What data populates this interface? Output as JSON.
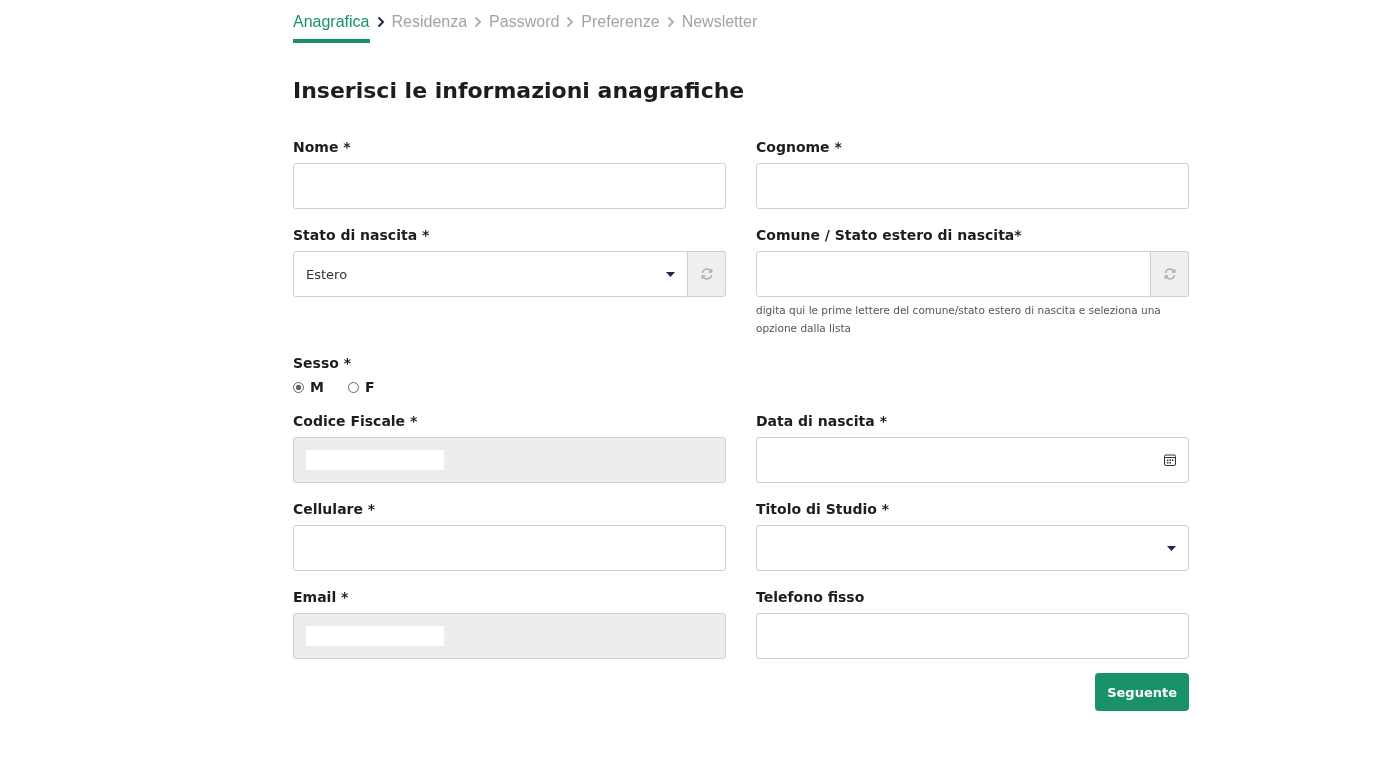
{
  "steps": [
    {
      "label": "Anagrafica",
      "selected": true
    },
    {
      "label": "Residenza",
      "selected": false
    },
    {
      "label": "Password",
      "selected": false
    },
    {
      "label": "Preferenze",
      "selected": false
    },
    {
      "label": "Newsletter",
      "selected": false
    }
  ],
  "heading": "Inserisci le informazioni anagrafiche",
  "fields": [
    {
      "kind": "text",
      "label": "Nome *"
    },
    {
      "kind": "text",
      "label": "Cognome *"
    },
    {
      "kind": "select",
      "label": "Stato di nascita *",
      "value": "Estero",
      "refresh": true
    },
    {
      "kind": "text",
      "label": "Comune / Stato estero di nascita*",
      "refresh": true,
      "hint": "digita qui le prime lettere del comune/stato estero di nascita e seleziona una opzione dalla lista"
    },
    {
      "kind": "radio",
      "label": "Sesso *",
      "options": [
        {
          "label": "M",
          "selected": true
        },
        {
          "label": "F",
          "selected": false
        }
      ]
    },
    {
      "kind": "spacer"
    },
    {
      "kind": "text",
      "label": "Codice Fiscale *",
      "disabled": true,
      "redacted": true
    },
    {
      "kind": "date",
      "label": "Data di nascita *"
    },
    {
      "kind": "text",
      "label": "Cellulare *"
    },
    {
      "kind": "select",
      "label": "Titolo di Studio *"
    },
    {
      "kind": "text",
      "label": "Email *",
      "disabled": true,
      "redacted": true
    },
    {
      "kind": "text",
      "label": "Telefono fisso"
    }
  ],
  "next_button": "Seguente"
}
